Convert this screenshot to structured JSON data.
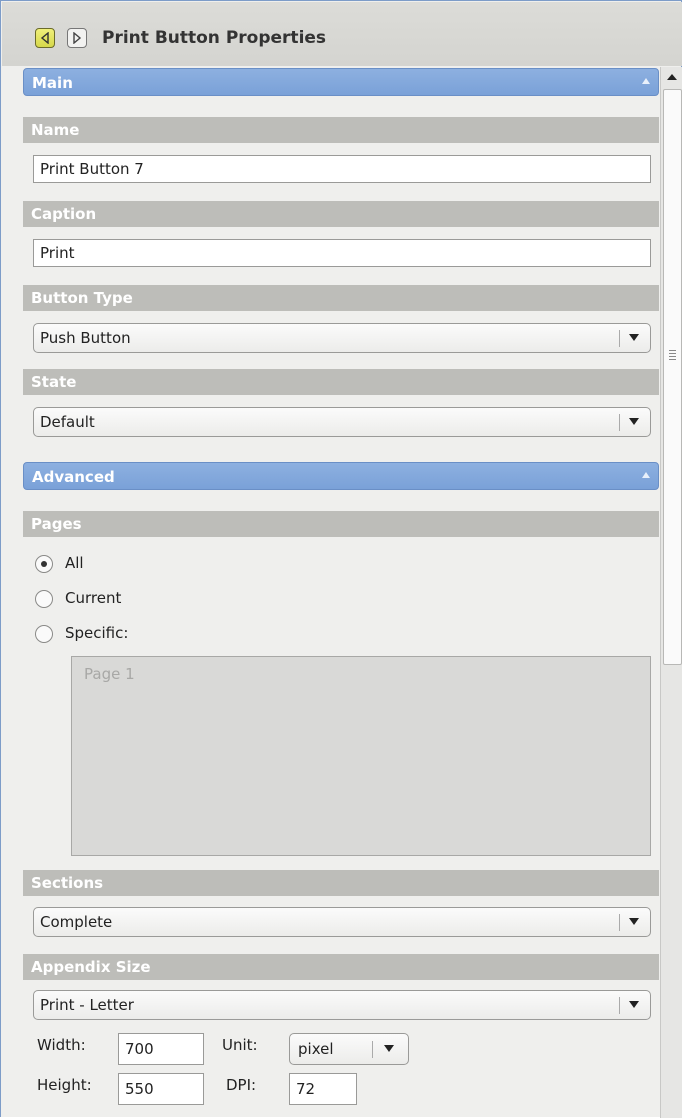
{
  "header": {
    "title": "Print Button Properties",
    "back_icon": "arrow-left-icon",
    "forward_icon": "arrow-right-icon"
  },
  "colors": {
    "section_header": "#7aa1d8",
    "group_label": "#bdbdb9",
    "panel_bg": "#efefed",
    "back_button": "#e0e25a"
  },
  "sections": {
    "main": {
      "label": "Main",
      "name_label": "Name",
      "name_value": "Print Button 7",
      "caption_label": "Caption",
      "caption_value": "Print",
      "button_type_label": "Button Type",
      "button_type_value": "Push Button",
      "state_label": "State",
      "state_value": "Default"
    },
    "advanced": {
      "label": "Advanced",
      "pages_label": "Pages",
      "pages_options": [
        {
          "label": "All",
          "selected": true
        },
        {
          "label": "Current",
          "selected": false
        },
        {
          "label": "Specific:",
          "selected": false
        }
      ],
      "specific_pages_placeholder": "Page 1",
      "sections_label": "Sections",
      "sections_value": "Complete",
      "appendix_label": "Appendix Size",
      "appendix_value": "Print - Letter",
      "width_label": "Width:",
      "width_value": "700",
      "height_label": "Height:",
      "height_value": "550",
      "unit_label": "Unit:",
      "unit_value": "pixel",
      "dpi_label": "DPI:",
      "dpi_value": "72"
    }
  }
}
